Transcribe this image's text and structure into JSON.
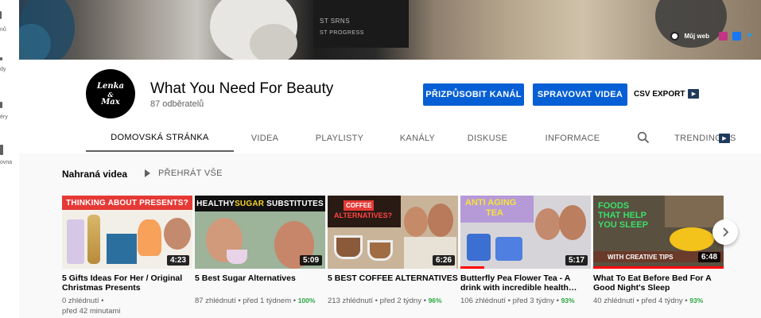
{
  "mini_guide": {
    "items": [
      {
        "icon": "trending-icon",
        "label": "nů"
      },
      {
        "icon": "subscriptions-icon",
        "label": "dy"
      },
      {
        "icon": "library-icon",
        "label": "éry"
      },
      {
        "icon": "history-icon",
        "label": "ovna"
      }
    ]
  },
  "banner": {
    "box_text_1": "ST SRNS",
    "box_text_2": "ST PROGRESS",
    "link_label": "Můj web",
    "links": [
      "globe-icon",
      "instagram-icon",
      "facebook-icon",
      "twitter-icon"
    ],
    "colors": {
      "instagram": "#c13584",
      "facebook": "#1877f2",
      "twitter": "#1da1f2"
    }
  },
  "channel": {
    "avatar_text_1": "Lenka",
    "avatar_text_2": "&",
    "avatar_text_3": "Max",
    "name": "What You Need For Beauty",
    "subscribers": "87 odběratelů"
  },
  "actions": {
    "customize": "PŘIZPŮSOBIT KANÁL",
    "manage": "SPRAVOVAT VIDEA",
    "csv": "CSV EXPORT",
    "accent": "#065fd4"
  },
  "tabs": [
    {
      "label": "DOMOVSKÁ STRÁNKA",
      "active": true
    },
    {
      "label": "VIDEA"
    },
    {
      "label": "PLAYLISTY"
    },
    {
      "label": "KANÁLY"
    },
    {
      "label": "DISKUSE"
    },
    {
      "label": "INFORMACE"
    },
    {
      "label": "TRENDING"
    },
    {
      "label": "S"
    }
  ],
  "section": {
    "title": "Nahraná videa",
    "play_all": "PŘEHRÁT VŠE"
  },
  "videos": [
    {
      "thumb_caption": "THINKING ABOUT PRESENTS?",
      "duration": "4:23",
      "progress": 0,
      "title": "5 Gifts Ideas For Her / Original Christmas Presents",
      "views": "0 zhlédnutí",
      "age": "před 42 minutami",
      "percent": ""
    },
    {
      "thumb_caption_1": "HEALTHY ",
      "thumb_caption_2": "SUGAR",
      "thumb_caption_3": " SUBSTITUTES",
      "duration": "5:09",
      "progress": 0,
      "title": "5 Best Sugar Alternatives",
      "views": "87 zhlédnutí",
      "age": "před 1 týdnem",
      "percent": "100%"
    },
    {
      "thumb_caption_1": "COFFEE",
      "thumb_caption_2": "ALTERNATIVES?",
      "duration": "6:26",
      "progress": 0,
      "title": "5 BEST COFFEE ALTERNATIVES",
      "views": "213 zhlédnutí",
      "age": "před 2 týdny",
      "percent": "96%"
    },
    {
      "thumb_caption_1": "ANTI AGING",
      "thumb_caption_2": "TEA",
      "duration": "5:17",
      "progress": 0.18,
      "title": "Butterfly Pea Flower Tea - A drink with incredible health…",
      "views": "106 zhlédnutí",
      "age": "před 3 týdny",
      "percent": "93%"
    },
    {
      "thumb_caption_1": "FOODS",
      "thumb_caption_2": "THAT HELP",
      "thumb_caption_3": "YOU SLEEP",
      "thumb_caption_4": "WITH CREATIVE TIPS",
      "duration": "6:48",
      "progress": 1,
      "title": "What To Eat Before Bed For A Good Night's Sleep",
      "views": "40 zhlédnutí",
      "age": "před 4 týdny",
      "percent": "93%"
    }
  ]
}
